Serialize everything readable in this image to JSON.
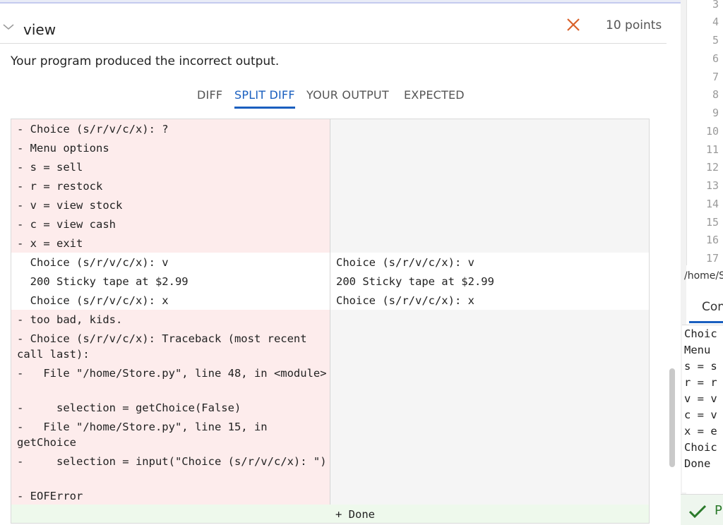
{
  "test": {
    "name": "view",
    "points": "10 points",
    "message": "Your program produced the incorrect output."
  },
  "tabs": [
    {
      "label": "DIFF",
      "active": false
    },
    {
      "label": "SPLIT DIFF",
      "active": true
    },
    {
      "label": "YOUR OUTPUT",
      "active": false
    },
    {
      "label": "EXPECTED",
      "active": false
    }
  ],
  "diff": {
    "left": [
      {
        "text": "- Choice (s/r/v/c/x): ?",
        "kind": "removed"
      },
      {
        "text": "- Menu options",
        "kind": "removed"
      },
      {
        "text": "- s = sell",
        "kind": "removed"
      },
      {
        "text": "- r = restock",
        "kind": "removed"
      },
      {
        "text": "- v = view stock",
        "kind": "removed"
      },
      {
        "text": "- c = view cash",
        "kind": "removed"
      },
      {
        "text": "- x = exit",
        "kind": "removed"
      },
      {
        "text": "  Choice (s/r/v/c/x): v",
        "kind": "same"
      },
      {
        "text": "  200 Sticky tape at $2.99",
        "kind": "same"
      },
      {
        "text": "  Choice (s/r/v/c/x): x",
        "kind": "same"
      },
      {
        "text": "- too bad, kids.",
        "kind": "removed"
      },
      {
        "text": "- Choice (s/r/v/c/x): Traceback (most recent call last):",
        "kind": "removed"
      },
      {
        "text": "-   File \"/home/Store.py\", line 48, in <module>",
        "kind": "removed"
      },
      {
        "text": "-     selection = getChoice(False)",
        "kind": "removed"
      },
      {
        "text": "-   File \"/home/Store.py\", line 15, in getChoice",
        "kind": "removed"
      },
      {
        "text": "-     selection = input(\"Choice (s/r/v/c/x): \")",
        "kind": "removed"
      },
      {
        "text": "- EOFError",
        "kind": "removed"
      }
    ],
    "right": [
      {
        "text": "Choice (s/r/v/c/x): v",
        "kind": "same"
      },
      {
        "text": "200 Sticky tape at $2.99",
        "kind": "same"
      },
      {
        "text": "Choice (s/r/v/c/x): x",
        "kind": "same"
      },
      {
        "text": "+ Done",
        "kind": "added"
      }
    ]
  },
  "editor": {
    "line_numbers": [
      "3",
      "4",
      "5",
      "6",
      "7",
      "8",
      "9",
      "10",
      "11",
      "12",
      "13",
      "14",
      "15",
      "16",
      "17"
    ],
    "path": "/home/S",
    "console_tab": "Con",
    "console_lines": [
      "Choic",
      "Menu ",
      "s = s",
      "r = r",
      "v = v",
      "c = v",
      "x = e",
      "Choic",
      "Done"
    ],
    "status_text": "P"
  },
  "colors": {
    "accent": "#1a5fbf",
    "fail": "#d9622b",
    "removed_bg": "#fdecec",
    "added_bg": "#eef9ec",
    "pass": "#2a7a2a"
  }
}
